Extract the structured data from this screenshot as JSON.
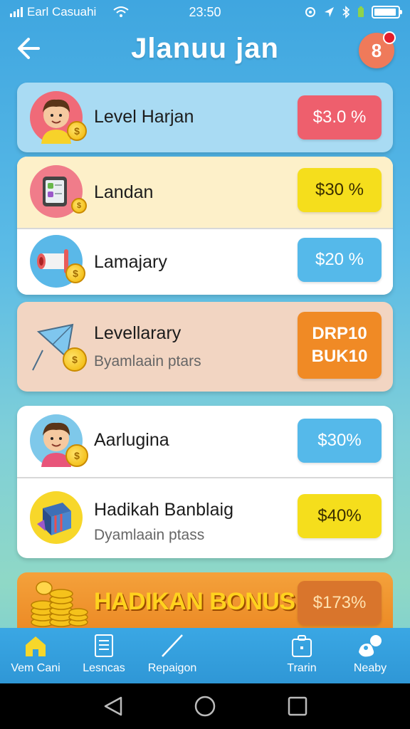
{
  "status_bar": {
    "carrier": "Earl Casuahi",
    "time": "23:50"
  },
  "header": {
    "title": "Jlanuu jan",
    "notification_count": "8"
  },
  "rows": [
    {
      "title": "Level Harjan",
      "subtitle": "",
      "value": "$3.0 %",
      "pill_color": "#ee5f6d"
    },
    {
      "title": "Landan",
      "subtitle": "",
      "value": "$30 %",
      "pill_color": "#f5de1c"
    },
    {
      "title": "Lamajary",
      "subtitle": "",
      "value": "$20 %",
      "pill_color": "#55b9ea"
    },
    {
      "title": "Levellarary",
      "subtitle": "Byamlaain ptars",
      "value_line1": "DRP10",
      "value_line2": "BUK10",
      "pill_color": "#f08a25"
    },
    {
      "title": "Aarlugina",
      "subtitle": "",
      "value": "$30%",
      "pill_color": "#55b9ea"
    },
    {
      "title": "Hadikah Banblaig",
      "subtitle": "Dyamlaain ptass",
      "value": "$40%",
      "pill_color": "#f5de1c"
    }
  ],
  "bonus": {
    "title": "HADIKAN BONUS",
    "value": "$173%"
  },
  "bottom_nav": [
    {
      "label": "Vem Cani",
      "icon": "home-icon"
    },
    {
      "label": "Lesncas",
      "icon": "document-icon"
    },
    {
      "label": "Repaigon",
      "icon": "pencil-icon"
    },
    {
      "label": "Trarin",
      "icon": "briefcase-icon"
    },
    {
      "label": "Neaby",
      "icon": "people-icon"
    }
  ],
  "colors": {
    "accent": "#3aa7e4",
    "card_blue": "#a9dbf3",
    "card_cream": "#fdf0c9",
    "card_peach": "#f2d5c2",
    "white": "#ffffff"
  }
}
